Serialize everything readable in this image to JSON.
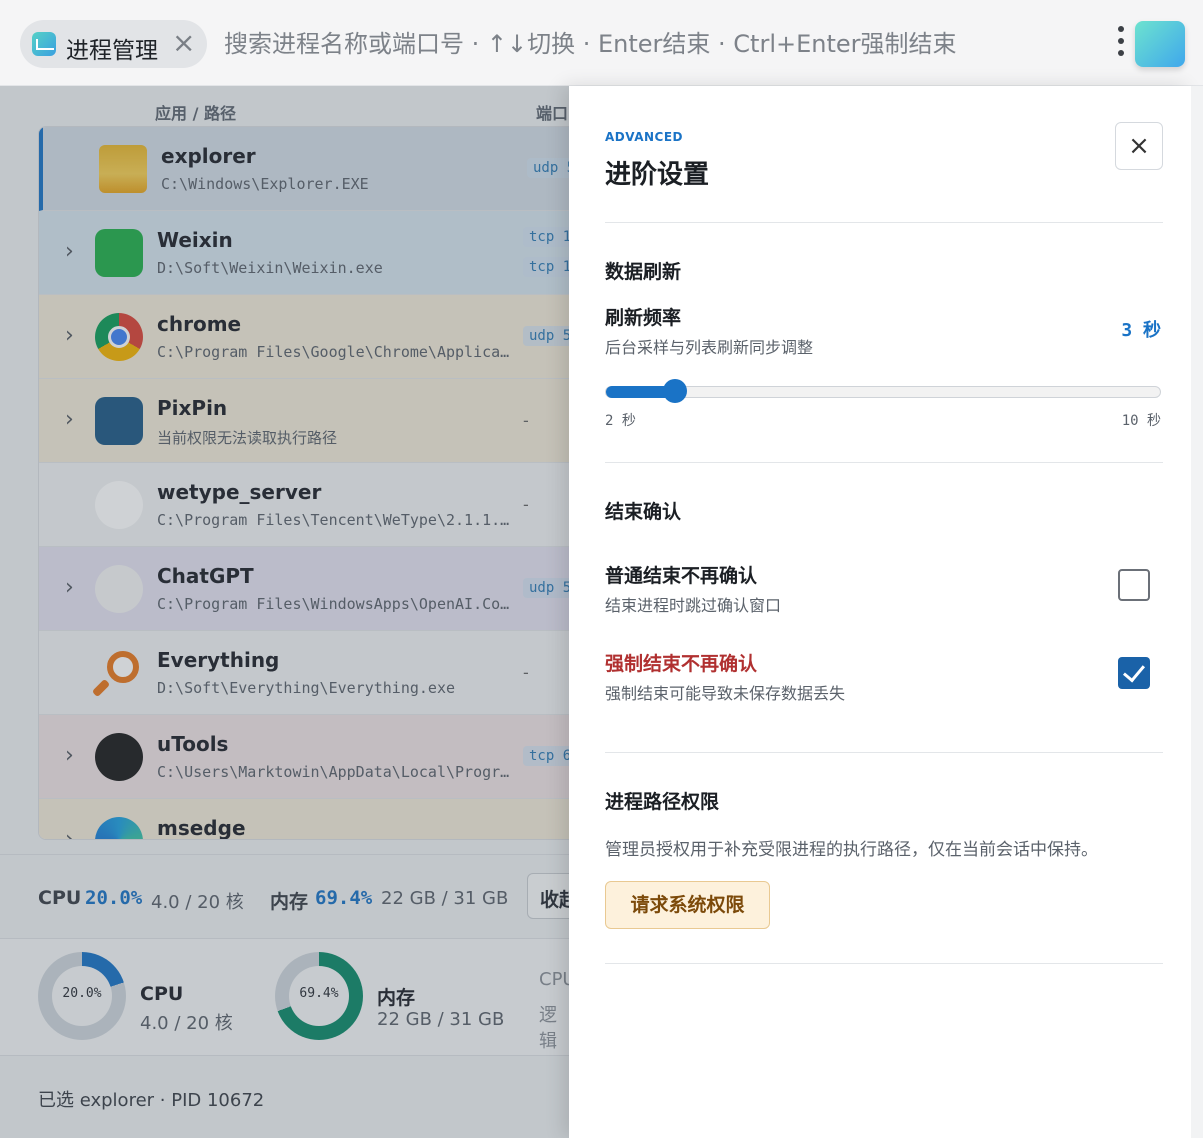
{
  "topbar": {
    "chip_label": "进程管理",
    "chip_close_icon": "×",
    "search_placeholder": "搜索进程名称或端口号 · ↑↓切换 · Enter结束 · Ctrl+Enter强制结束"
  },
  "list": {
    "col_app": "应用 / 路径",
    "col_port": "端口",
    "rows": [
      {
        "name": "explorer",
        "path": "C:\\Windows\\Explorer.EXE",
        "ports": [
          "udp 5"
        ],
        "expandable": false,
        "bg": "#d3dce6",
        "icon": "folder-icon"
      },
      {
        "name": "Weixin",
        "path": "D:\\Soft\\Weixin\\Weixin.exe",
        "ports": [
          "tcp 1",
          "tcp 1"
        ],
        "expandable": true,
        "bg": "#d6e4ee",
        "icon": "wechat-icon"
      },
      {
        "name": "chrome",
        "path": "C:\\Program Files\\Google\\Chrome\\Applica…",
        "ports": [
          "udp 5"
        ],
        "expandable": true,
        "bg": "#f2ead8",
        "icon": "chrome-icon"
      },
      {
        "name": "PixPin",
        "path": "当前权限无法读取执行路径",
        "ports": [],
        "expandable": true,
        "bg": "#f2ead8",
        "icon": "pixpin-icon"
      },
      {
        "name": "wetype_server",
        "path": "C:\\Program Files\\Tencent\\WeType\\2.1.1.…",
        "ports": [],
        "expandable": false,
        "bg": "#f1f2f3",
        "icon": "wetype-icon"
      },
      {
        "name": "ChatGPT",
        "path": "C:\\Program Files\\WindowsApps\\OpenAI.Co…",
        "ports": [
          "udp 5"
        ],
        "expandable": true,
        "bg": "#e4e2f0",
        "icon": "chatgpt-icon"
      },
      {
        "name": "Everything",
        "path": "D:\\Soft\\Everything\\Everything.exe",
        "ports": [],
        "expandable": false,
        "bg": "#f1f2f3",
        "icon": "everything-icon"
      },
      {
        "name": "uTools",
        "path": "C:\\Users\\Marktowin\\AppData\\Local\\Progr…",
        "ports": [
          "tcp 6"
        ],
        "expandable": true,
        "bg": "#efe3e5",
        "icon": "utools-icon"
      },
      {
        "name": "msedge",
        "path": "",
        "ports": [],
        "expandable": true,
        "bg": "#f2ead8",
        "icon": "edge-icon"
      }
    ],
    "dash": "-",
    "chevron": "›"
  },
  "stats": {
    "cpu_label": "CPU",
    "cpu_value": "20.0%",
    "cpu_sub": "4.0 / 20 核",
    "mem_label": "内存",
    "mem_value": "69.4%",
    "mem_sub": "22 GB / 31 GB",
    "collapse_btn": "收起"
  },
  "gauges": {
    "cpu": {
      "pct_text": "20.0%",
      "fraction": 0.2,
      "title": "CPU",
      "sub": "4.0 / 20 核",
      "color": "#1a73c6"
    },
    "mem": {
      "pct_text": "69.4%",
      "fraction": 0.694,
      "title": "内存",
      "sub": "22 GB / 31 GB",
      "color": "#0e8a6a"
    },
    "extra_title": "CPU",
    "extra_sub": "逻辑"
  },
  "footer": {
    "selected": "已选 explorer · PID 10672"
  },
  "panel": {
    "eyebrow": "ADVANCED",
    "title": "进阶设置",
    "close_icon": "×",
    "refresh_section": "数据刷新",
    "refresh_title": "刷新频率",
    "refresh_desc": "后台采样与列表刷新同步调整",
    "refresh_value": "3 秒",
    "slider": {
      "min": 2,
      "max": 10,
      "value": 3,
      "min_label": "2 秒",
      "max_label": "10 秒"
    },
    "confirm_section": "结束确认",
    "normal_title": "普通结束不再确认",
    "normal_desc": "结束进程时跳过确认窗口",
    "normal_checked": false,
    "force_title": "强制结束不再确认",
    "force_desc": "强制结束可能导致未保存数据丢失",
    "force_checked": true,
    "perm_section": "进程路径权限",
    "perm_desc": "管理员授权用于补充受限进程的执行路径，仅在当前会话中保持。",
    "perm_button": "请求系统权限"
  },
  "colors": {
    "accent": "#1a73c6",
    "danger": "#b03030",
    "warn_bg": "#fdf1dc"
  }
}
